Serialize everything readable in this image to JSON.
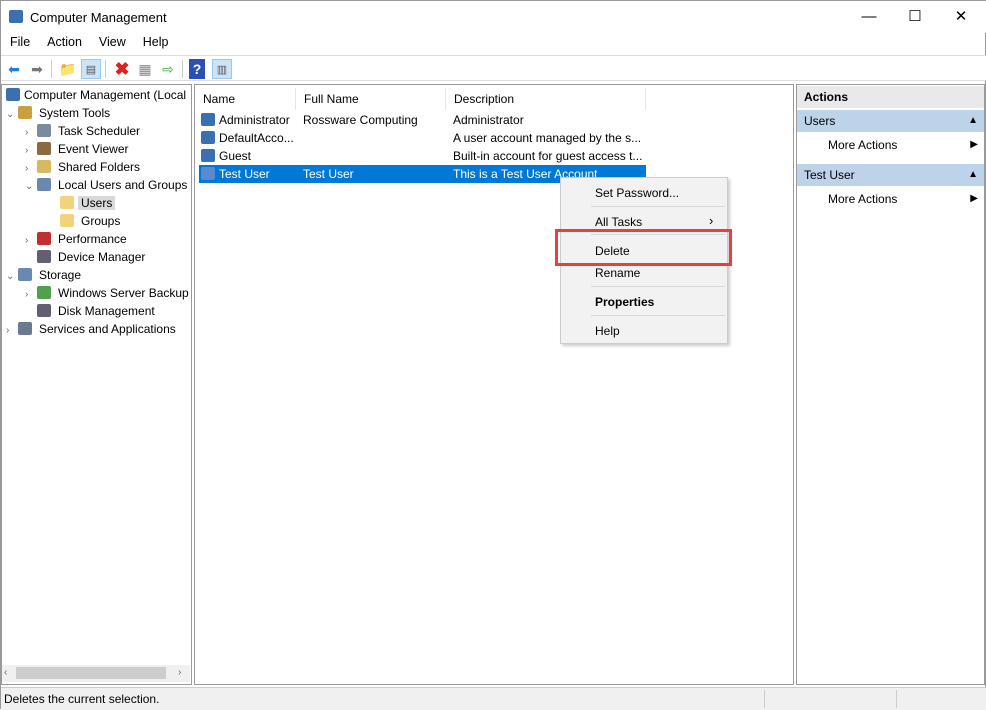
{
  "window": {
    "title": "Computer Management",
    "minimize": "—",
    "maximize": "☐",
    "close": "✕"
  },
  "menu": [
    "File",
    "Action",
    "View",
    "Help"
  ],
  "toolbar": [
    "back",
    "forward",
    "up-folder",
    "show-hide-tree",
    "delete",
    "properties",
    "export-list",
    "help",
    "show-hide-action-pane"
  ],
  "tree": {
    "root": "Computer Management (Local",
    "items": [
      {
        "label": "System Tools",
        "indent": 1,
        "arrow": "⌄"
      },
      {
        "label": "Task Scheduler",
        "indent": 2,
        "arrow": "›"
      },
      {
        "label": "Event Viewer",
        "indent": 2,
        "arrow": "›"
      },
      {
        "label": "Shared Folders",
        "indent": 2,
        "arrow": "›"
      },
      {
        "label": "Local Users and Groups",
        "indent": 2,
        "arrow": "⌄"
      },
      {
        "label": "Users",
        "indent": 3,
        "arrow": ""
      },
      {
        "label": "Groups",
        "indent": 3,
        "arrow": ""
      },
      {
        "label": "Performance",
        "indent": 2,
        "arrow": "›"
      },
      {
        "label": "Device Manager",
        "indent": 2,
        "arrow": ""
      },
      {
        "label": "Storage",
        "indent": 1,
        "arrow": "⌄"
      },
      {
        "label": "Windows Server Backup",
        "indent": 2,
        "arrow": "›"
      },
      {
        "label": "Disk Management",
        "indent": 2,
        "arrow": ""
      },
      {
        "label": "Services and Applications",
        "indent": 1,
        "arrow": "›"
      }
    ]
  },
  "list": {
    "columns": [
      "Name",
      "Full Name",
      "Description"
    ],
    "rows": [
      {
        "name": "Administrator",
        "full_name": "Rossware Computing",
        "description": "Administrator"
      },
      {
        "name": "DefaultAcco...",
        "full_name": "",
        "description": "A user account managed by the s..."
      },
      {
        "name": "Guest",
        "full_name": "",
        "description": "Built-in account for guest access t..."
      },
      {
        "name": "Test User",
        "full_name": "Test User",
        "description": "This is a Test User Account"
      }
    ]
  },
  "context_menu": {
    "items": [
      "Set Password...",
      "All Tasks",
      "Delete",
      "Rename",
      "Properties",
      "Help"
    ],
    "submenu_arrow": "›"
  },
  "actions": {
    "title": "Actions",
    "sections": [
      {
        "header": "Users",
        "item": "More Actions"
      },
      {
        "header": "Test User",
        "item": "More Actions"
      }
    ]
  },
  "status": "Deletes the current selection."
}
